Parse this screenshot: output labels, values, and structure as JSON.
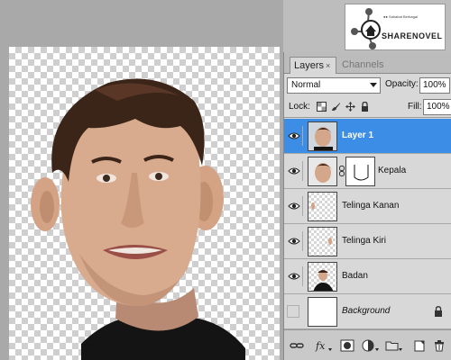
{
  "watermark": {
    "subtitle": "●● Sahabat Berbagai",
    "name": "SHARENOVEL"
  },
  "panel": {
    "tabs": [
      {
        "label": "Layers",
        "close": "×"
      },
      {
        "label": "Channels"
      }
    ],
    "blend_mode": "Normal",
    "opacity_label": "Opacity:",
    "opacity_value": "100%",
    "lock_label": "Lock:",
    "fill_label": "Fill:",
    "fill_value": "100%"
  },
  "layers": [
    {
      "name": "Layer 1",
      "visible": true,
      "selected": true
    },
    {
      "name": "Kepala",
      "visible": true,
      "selected": false,
      "has_mask": true
    },
    {
      "name": "Telinga Kanan",
      "visible": true,
      "selected": false
    },
    {
      "name": "Telinga Kiri",
      "visible": true,
      "selected": false
    },
    {
      "name": "Badan",
      "visible": true,
      "selected": false
    },
    {
      "name": "Background",
      "visible": false,
      "selected": false,
      "locked": true
    }
  ],
  "colors": {
    "selection": "#3b8de6",
    "panel": "#d8d8d8",
    "canvas_bg": "#a9a9a9"
  },
  "icons": [
    "eye-icon",
    "chain-link-icon",
    "lock-icon",
    "link-layers-icon",
    "fx-icon",
    "mask-icon",
    "adjustment-icon",
    "folder-icon",
    "new-layer-icon",
    "trash-icon"
  ]
}
